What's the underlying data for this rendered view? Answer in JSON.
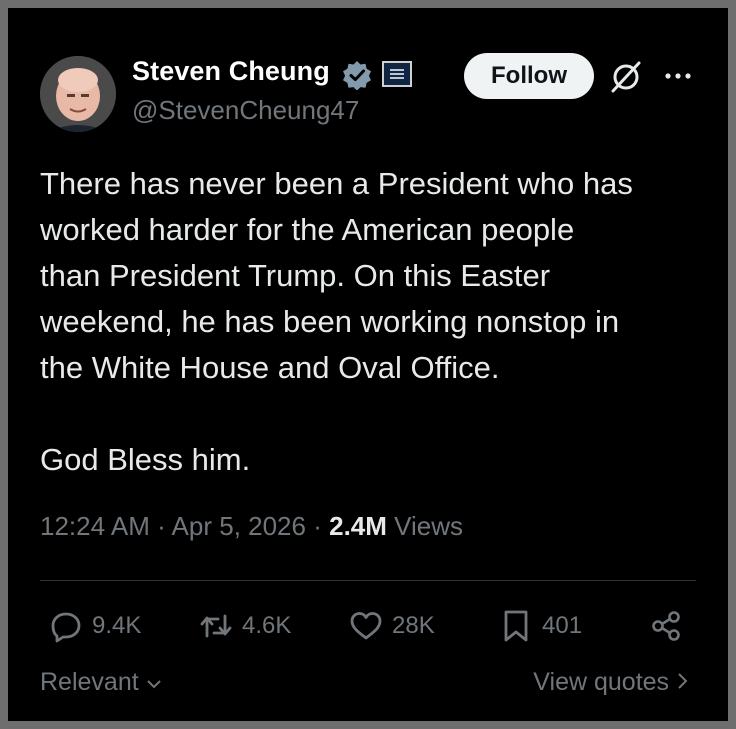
{
  "author": {
    "display_name": "Steven Cheung",
    "handle": "@StevenCheung47",
    "verified_icon": "verified-badge-icon",
    "affiliation_icon": "white-house-affiliation-badge"
  },
  "header": {
    "follow_label": "Follow",
    "grok_icon": "grok-icon",
    "more_icon": "more-icon"
  },
  "tweet": {
    "text": "There has never been a President who has\nworked harder for the American people\nthan President Trump. On this Easter\nweekend, he has been working nonstop in\nthe White House and Oval Office.\n\nGod Bless him.",
    "time": "12:24 AM",
    "date": "Apr 5, 2026",
    "views_count": "2.4M",
    "views_label": "Views"
  },
  "actions": {
    "replies": "9.4K",
    "reposts": "4.6K",
    "likes": "28K",
    "bookmarks": "401"
  },
  "footer": {
    "sort_label": "Relevant",
    "quotes_label": "View quotes"
  },
  "colors": {
    "background": "#000000",
    "text": "#e7e9ea",
    "muted": "#71767b",
    "verified": "#829aab"
  }
}
